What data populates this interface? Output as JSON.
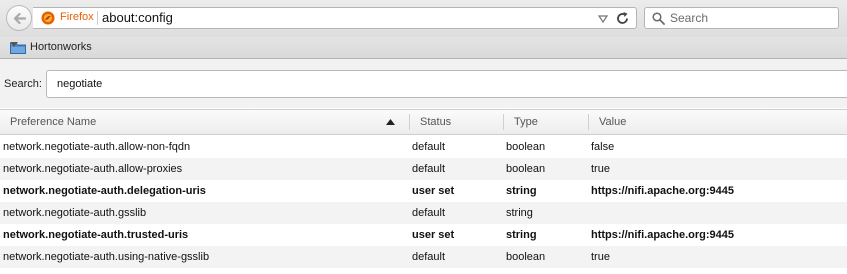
{
  "toolbar": {
    "identity_label": "Firefox",
    "url": "about:config",
    "search_placeholder": "Search"
  },
  "bookmarks": {
    "folder_label": "Hortonworks"
  },
  "filter": {
    "label": "Search:",
    "value": "negotiate"
  },
  "columns": {
    "name": "Preference Name",
    "status": "Status",
    "type": "Type",
    "value": "Value"
  },
  "rows": [
    {
      "name": "network.negotiate-auth.allow-non-fqdn",
      "status": "default",
      "type": "boolean",
      "value": "false",
      "modified": false
    },
    {
      "name": "network.negotiate-auth.allow-proxies",
      "status": "default",
      "type": "boolean",
      "value": "true",
      "modified": false
    },
    {
      "name": "network.negotiate-auth.delegation-uris",
      "status": "user set",
      "type": "string",
      "value": "https://nifi.apache.org:9445",
      "modified": true
    },
    {
      "name": "network.negotiate-auth.gsslib",
      "status": "default",
      "type": "string",
      "value": "",
      "modified": false
    },
    {
      "name": "network.negotiate-auth.trusted-uris",
      "status": "user set",
      "type": "string",
      "value": "https://nifi.apache.org:9445",
      "modified": true
    },
    {
      "name": "network.negotiate-auth.using-native-gsslib",
      "status": "default",
      "type": "boolean",
      "value": "true",
      "modified": false
    }
  ],
  "colors": {
    "identity": "#e66000",
    "folder": "#3a7bd5",
    "row_stripe": "#f3f3f3"
  },
  "icons": {
    "back": "back-arrow-icon",
    "firefox": "firefox-logo-icon",
    "reload": "reload-icon",
    "search": "magnifier-icon",
    "folder": "folder-icon",
    "sort": "sort-ascending-icon"
  }
}
